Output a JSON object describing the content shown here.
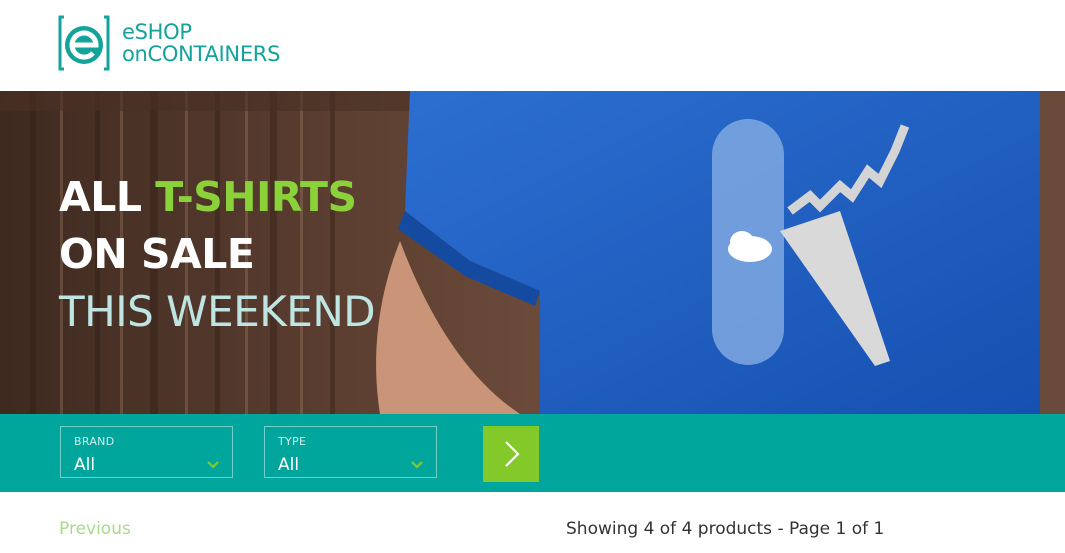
{
  "header": {
    "logo_line1": "eSHOP",
    "logo_line2": "onCONTAINERS"
  },
  "hero": {
    "line1_a": "ALL ",
    "line1_b": "T-SHIRTS",
    "line2": "ON SALE",
    "line3": "THIS WEEKEND"
  },
  "filters": {
    "brand": {
      "label": "BRAND",
      "value": "All"
    },
    "type": {
      "label": "TYPE",
      "value": "All"
    }
  },
  "pager": {
    "previous": "Previous",
    "info": "Showing 4 of 4 products - Page 1 of 1"
  },
  "colors": {
    "brand_teal": "#00a69c",
    "accent_green": "#84c92a",
    "tshirt_blue": "#1f5fc4"
  }
}
